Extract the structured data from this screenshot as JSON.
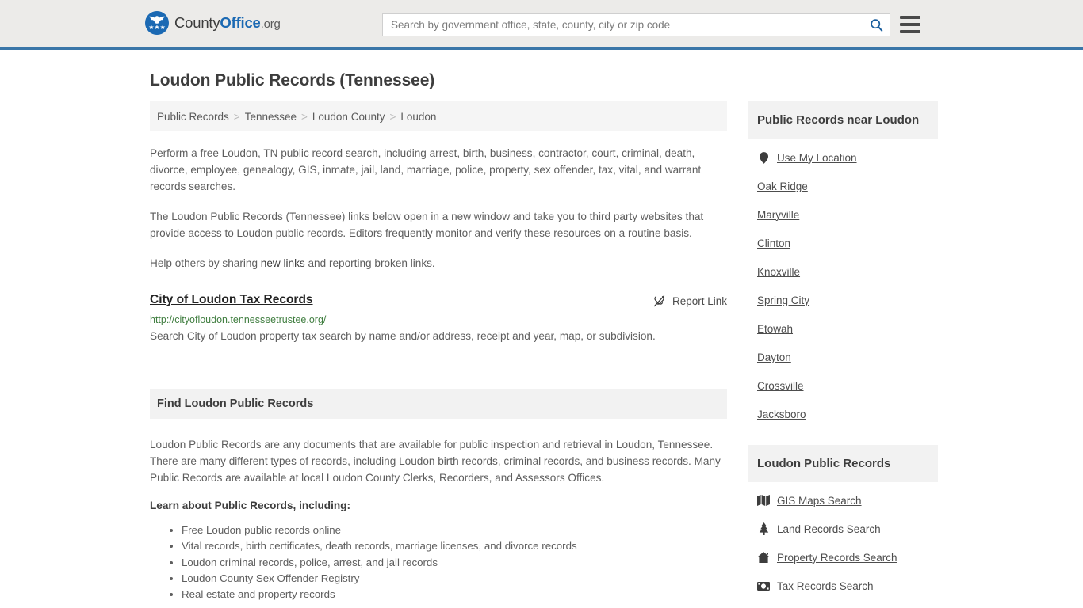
{
  "header": {
    "logo": {
      "part1": "County",
      "part2": "Office",
      "part3": ".org",
      "icon": "eagle-seal-logo"
    },
    "search": {
      "placeholder": "Search by government office, state, county, city or zip code",
      "value": "",
      "icon": "search-icon"
    },
    "menu_icon": "hamburger-menu-icon",
    "accent_color": "#3a76a8",
    "background_color": "#ecebe9"
  },
  "page": {
    "title": "Loudon Public Records (Tennessee)"
  },
  "breadcrumb": {
    "items": [
      {
        "label": "Public Records"
      },
      {
        "label": "Tennessee"
      },
      {
        "label": "Loudon County"
      },
      {
        "label": "Loudon"
      }
    ],
    "separator": ">"
  },
  "intro": {
    "p1": "Perform a free Loudon, TN public record search, including arrest, birth, business, contractor, court, criminal, death, divorce, employee, genealogy, GIS, inmate, jail, land, marriage, police, property, sex offender, tax, vital, and warrant records searches.",
    "p2": "The Loudon Public Records (Tennessee) links below open in a new window and take you to third party websites that provide access to Loudon public records. Editors frequently monitor and verify these resources on a routine basis.",
    "p3_before": "Help others by sharing ",
    "p3_link": "new links",
    "p3_after": " and reporting broken links."
  },
  "record": {
    "title": "City of Loudon Tax Records",
    "url": "http://cityofloudon.tennesseetrustee.org/",
    "description": "Search City of Loudon property tax search by name and/or address, receipt and year, map, or subdivision.",
    "report_label": "Report Link",
    "report_icon": "broken-link-icon",
    "url_color": "#3f7d3f"
  },
  "section": {
    "heading": "Find Loudon Public Records",
    "paragraph": "Loudon Public Records are any documents that are available for public inspection and retrieval in Loudon, Tennessee. There are many different types of records, including Loudon birth records, criminal records, and business records. Many Public Records are available at local Loudon County Clerks, Recorders, and Assessors Offices.",
    "lead_in": "Learn about Public Records, including:",
    "bullets": [
      "Free Loudon public records online",
      "Vital records, birth certificates, death records, marriage licenses, and divorce records",
      "Loudon criminal records, police, arrest, and jail records",
      "Loudon County Sex Offender Registry",
      "Real estate and property records"
    ]
  },
  "sidebar": {
    "nearby": {
      "heading": "Public Records near Loudon",
      "use_my_location": {
        "label": "Use My Location",
        "icon": "map-pin-icon"
      },
      "cities": [
        "Oak Ridge",
        "Maryville",
        "Clinton",
        "Knoxville",
        "Spring City",
        "Etowah",
        "Dayton",
        "Crossville",
        "Jacksboro"
      ]
    },
    "records": {
      "heading": "Loudon Public Records",
      "items": [
        {
          "label": "GIS Maps Search",
          "icon": "map-icon"
        },
        {
          "label": "Land Records Search",
          "icon": "tree-icon"
        },
        {
          "label": "Property Records Search",
          "icon": "house-icon"
        },
        {
          "label": "Tax Records Search",
          "icon": "money-icon"
        }
      ]
    }
  }
}
